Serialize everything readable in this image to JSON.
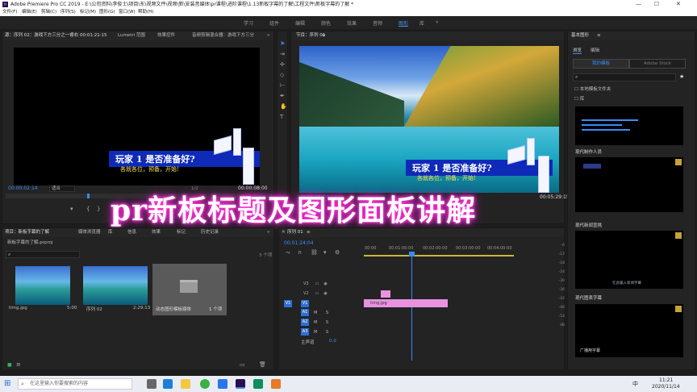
{
  "window": {
    "title": "Adobe Premiere Pro CC 2019 - E:\\公司资料\\李俊士\\项目\\东\\视频文件\\视频\\新\\安装音媒体\\pr课程\\进阶课程\\1.13新板字幕的了解\\工程文件\\新板字幕的了解 *",
    "controls": [
      "—",
      "☐",
      "✕"
    ]
  },
  "menu": [
    "文件(F)",
    "编辑(E)",
    "剪辑(C)",
    "序列(S)",
    "标记(M)",
    "图形(G)",
    "窗口(W)",
    "帮助(H)"
  ],
  "workspaces": {
    "items": [
      "学习",
      "组件",
      "编辑",
      "颜色",
      "效果",
      "音频",
      "图形",
      "库"
    ],
    "active": "图形",
    "more": "»"
  },
  "source_panel": {
    "tabs": [
      "源：序列 02：游戏下方三分之一睿右 00:01:21:15",
      "Lumetri 范围",
      "效果控件",
      "音频剪辑混合器：游戏下方三分"
    ],
    "more": "»",
    "timecode": "00:00:02:14",
    "fit": "适合",
    "fraction": "1/2",
    "duration": "00:00:08:00"
  },
  "lower_third": {
    "line1": "玩家 1 是否准备好?",
    "line2": "各就各位，预备，开始!"
  },
  "program_panel": {
    "tab": "节目：序列 01",
    "menu": "≡",
    "timecode": "00:01:24:04",
    "end": "00:05:29:15"
  },
  "overlay_title": "pr新板标题及图形面板讲解",
  "project_panel": {
    "tabs": [
      "项目：新板字幕的了解",
      "媒体浏览器",
      "库",
      "信息",
      "效果",
      "标记",
      "历史记录"
    ],
    "more": "»",
    "path": "新板字幕的了解.prproj",
    "count": "3 个项",
    "items": [
      {
        "name": "timg.jpg",
        "duration": "5:00"
      },
      {
        "name": "序列 02",
        "duration": "2:29:13"
      },
      {
        "name": "动态图形模板媒体",
        "duration": "1 个项"
      }
    ]
  },
  "timeline": {
    "title": "序列 01",
    "menu": "≡",
    "timecode": "00:01:24:04",
    "ruler": [
      "00:00",
      "00:01:00:00",
      "00:02:00:00",
      "00:03:00:00",
      "00:04:00:00"
    ],
    "tracks": [
      "V3",
      "V2",
      "V1",
      "A1",
      "A2",
      "A3"
    ],
    "src_v": "V1",
    "src_a": "A1",
    "clip": "timg.jpg",
    "master": "主声道",
    "master_val": "0.0",
    "audio_ticks": [
      "-6",
      "-12",
      "-18",
      "-24",
      "-30",
      "-36",
      "-42",
      "-48",
      "-54",
      "dB"
    ],
    "ms": [
      "M",
      "S"
    ]
  },
  "essential_graphics": {
    "title": "基本图形",
    "menu": "≡",
    "tabs": [
      "浏览",
      "编辑"
    ],
    "buttons": [
      "我的模板",
      "Adobe Stock"
    ],
    "search_placeholder": "",
    "checkbox1": "本地模板文件夹",
    "checkbox2": "库",
    "templates": [
      "现代制作人员",
      "现代新闻宣挑",
      "现代图表字幕"
    ],
    "preview1_text": "现代制作人员",
    "preview2_text": "在此输入新闻字幕",
    "preview3_text": "广播用字幕"
  },
  "taskbar": {
    "search_placeholder": "在这里输入你要搜索的内容",
    "time": "11:21",
    "date": "2020/11/14",
    "ime": "中"
  },
  "colors": {
    "accent": "#3d8af7",
    "clip": "#e892e0",
    "title_glow": "#ff2fd6",
    "lower_third": "#0f2ab8"
  }
}
